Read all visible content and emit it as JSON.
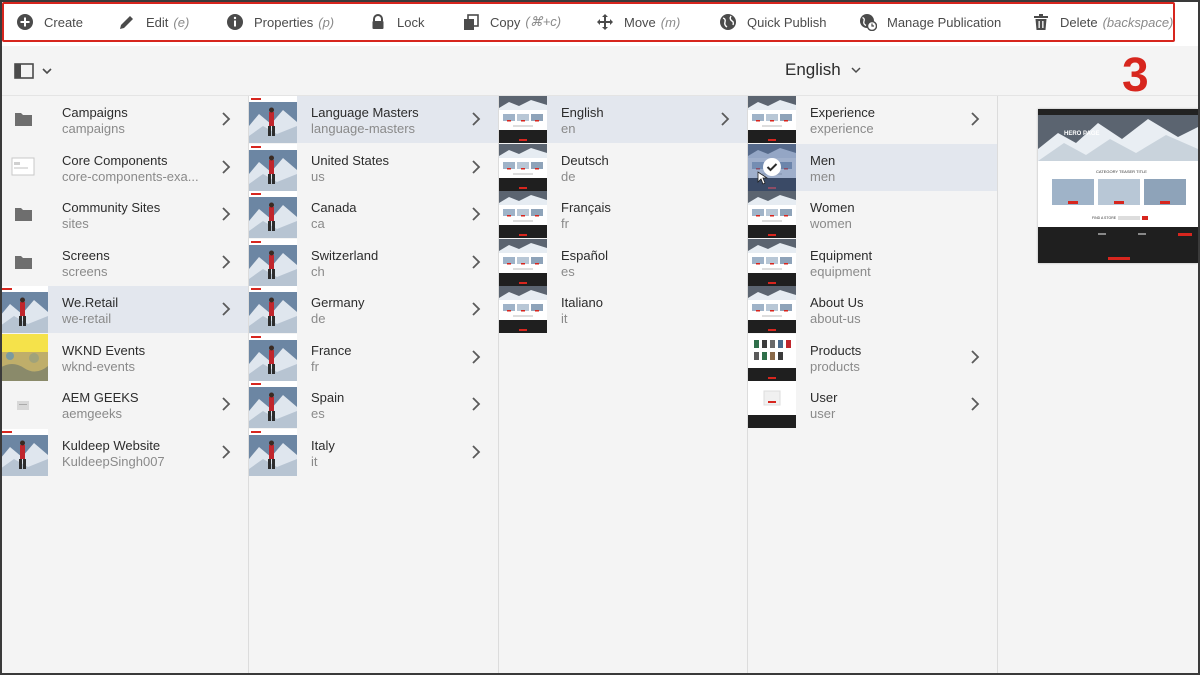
{
  "toolbar": {
    "actions": [
      {
        "label": "Create",
        "shortcut": "",
        "icon": "add-circle-icon"
      },
      {
        "label": "Edit",
        "shortcut": "(e)",
        "icon": "pencil-icon"
      },
      {
        "label": "Properties",
        "shortcut": "(p)",
        "icon": "info-icon"
      },
      {
        "label": "Lock",
        "shortcut": "",
        "icon": "lock-icon"
      },
      {
        "label": "Copy",
        "shortcut": "(⌘+c)",
        "icon": "copy-icon"
      },
      {
        "label": "Move",
        "shortcut": "(m)",
        "icon": "move-icon"
      },
      {
        "label": "Quick Publish",
        "shortcut": "",
        "icon": "globe-icon"
      },
      {
        "label": "Manage Publication",
        "shortcut": "",
        "icon": "globe-clock-icon"
      },
      {
        "label": "Delete",
        "shortcut": "(backspace)",
        "icon": "trash-icon"
      }
    ],
    "highlight_color": "#d7261e"
  },
  "header": {
    "language": "English",
    "annotation_number": "3"
  },
  "columns": [
    {
      "items": [
        {
          "title": "Campaigns",
          "name": "campaigns",
          "thumb": "folder",
          "has_children": true,
          "selected": false
        },
        {
          "title": "Core Components",
          "name": "core-components-exa...",
          "thumb": "page-outline",
          "has_children": true,
          "selected": false
        },
        {
          "title": "Community Sites",
          "name": "sites",
          "thumb": "folder",
          "has_children": true,
          "selected": false
        },
        {
          "title": "Screens",
          "name": "screens",
          "thumb": "folder",
          "has_children": true,
          "selected": false
        },
        {
          "title": "We.Retail",
          "name": "we-retail",
          "thumb": "climber",
          "has_children": true,
          "selected": true
        },
        {
          "title": "WKND Events",
          "name": "wknd-events",
          "thumb": "wknd",
          "has_children": false,
          "selected": false
        },
        {
          "title": "AEM GEEKS",
          "name": "aemgeeks",
          "thumb": "small-page",
          "has_children": true,
          "selected": false
        },
        {
          "title": "Kuldeep Website",
          "name": "KuldeepSingh007",
          "thumb": "climber",
          "has_children": true,
          "selected": false
        }
      ]
    },
    {
      "items": [
        {
          "title": "Language Masters",
          "name": "language-masters",
          "thumb": "climber",
          "has_children": true,
          "selected": true
        },
        {
          "title": "United States",
          "name": "us",
          "thumb": "climber",
          "has_children": true,
          "selected": false
        },
        {
          "title": "Canada",
          "name": "ca",
          "thumb": "climber",
          "has_children": true,
          "selected": false
        },
        {
          "title": "Switzerland",
          "name": "ch",
          "thumb": "climber",
          "has_children": true,
          "selected": false
        },
        {
          "title": "Germany",
          "name": "de",
          "thumb": "climber",
          "has_children": true,
          "selected": false
        },
        {
          "title": "France",
          "name": "fr",
          "thumb": "climber",
          "has_children": true,
          "selected": false
        },
        {
          "title": "Spain",
          "name": "es",
          "thumb": "climber",
          "has_children": true,
          "selected": false
        },
        {
          "title": "Italy",
          "name": "it",
          "thumb": "climber",
          "has_children": true,
          "selected": false
        }
      ]
    },
    {
      "items": [
        {
          "title": "English",
          "name": "en",
          "thumb": "web-page",
          "has_children": true,
          "selected": true
        },
        {
          "title": "Deutsch",
          "name": "de",
          "thumb": "web-page",
          "has_children": false,
          "selected": false
        },
        {
          "title": "Français",
          "name": "fr",
          "thumb": "web-page",
          "has_children": false,
          "selected": false
        },
        {
          "title": "Español",
          "name": "es",
          "thumb": "web-page",
          "has_children": false,
          "selected": false
        },
        {
          "title": "Italiano",
          "name": "it",
          "thumb": "web-page",
          "has_children": false,
          "selected": false
        }
      ]
    },
    {
      "items": [
        {
          "title": "Experience",
          "name": "experience",
          "thumb": "web-page",
          "has_children": true,
          "selected": false
        },
        {
          "title": "Men",
          "name": "men",
          "thumb": "web-page-checked",
          "has_children": false,
          "selected": true
        },
        {
          "title": "Women",
          "name": "women",
          "thumb": "web-page",
          "has_children": false,
          "selected": false
        },
        {
          "title": "Equipment",
          "name": "equipment",
          "thumb": "web-page",
          "has_children": false,
          "selected": false
        },
        {
          "title": "About Us",
          "name": "about-us",
          "thumb": "web-page",
          "has_children": false,
          "selected": false
        },
        {
          "title": "Products",
          "name": "products",
          "thumb": "products-page",
          "has_children": true,
          "selected": false
        },
        {
          "title": "User",
          "name": "user",
          "thumb": "blank-page",
          "has_children": true,
          "selected": false
        }
      ]
    }
  ],
  "preview": {
    "hero_text": "HERO PAGE",
    "section_text": "CATEGORY TEASER TITLE",
    "cta_text": "FIND A STORE"
  }
}
